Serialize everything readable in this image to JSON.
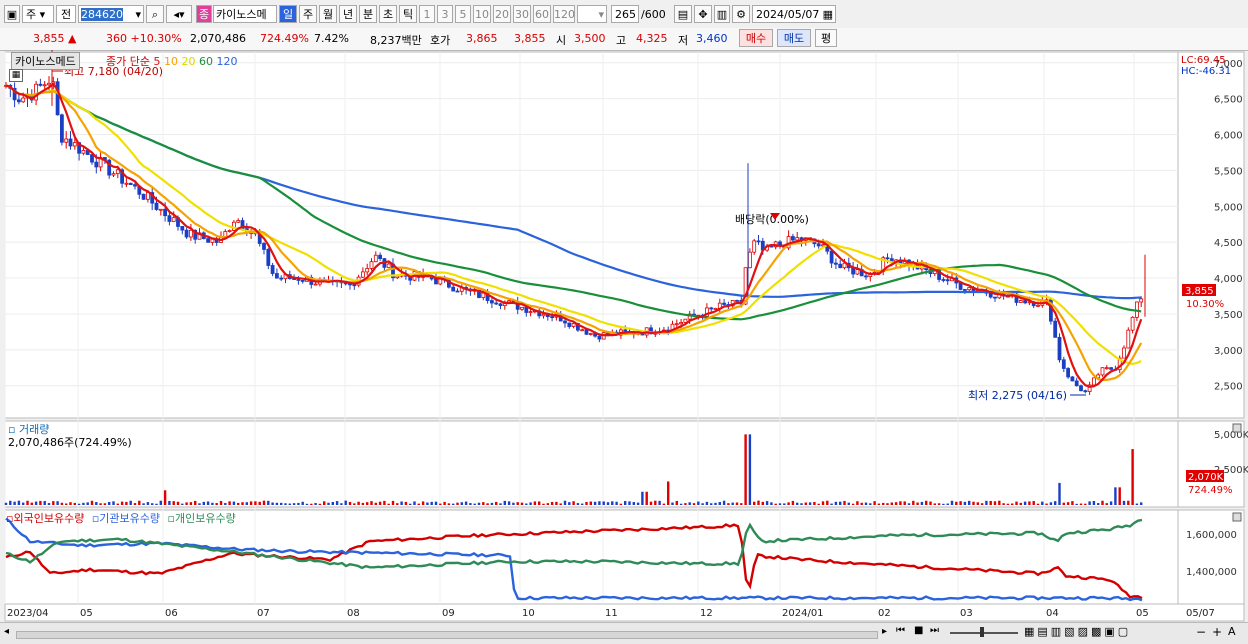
{
  "toolbar": {
    "type_select": "주",
    "range_select": "전",
    "code": "284620",
    "stock_badge": "종",
    "stock_name": "카이노스메",
    "periods": [
      "일",
      "주",
      "월",
      "년",
      "분",
      "초",
      "틱"
    ],
    "active_period": "일",
    "intervals": [
      "1",
      "3",
      "5",
      "10",
      "20",
      "30",
      "60",
      "120"
    ],
    "count": "265",
    "count_total": "/600",
    "date": "2024/05/07"
  },
  "info": {
    "price": "3,855",
    "change": "360 +10.30%",
    "volume": "2,070,486",
    "vol_ratio": "724.49%",
    "turnover": "7.42%",
    "amount": "8,237백만",
    "quote_label": "호가",
    "ask": "3,865",
    "bid": "3,855",
    "open_label": "시",
    "open": "3,500",
    "high_label": "고",
    "high": "4,325",
    "low_label": "저",
    "low": "3,460",
    "buy": "매수",
    "sell": "매도",
    "eval": "평"
  },
  "price_panel": {
    "name_tag": "카이노스메드",
    "ma_label": "종가 단순",
    "ma_periods": [
      {
        "p": "5",
        "color": "#e11111"
      },
      {
        "p": "10",
        "color": "#f5a300"
      },
      {
        "p": "20",
        "color": "#e8e800"
      },
      {
        "p": "60",
        "color": "#1a8f3a"
      },
      {
        "p": "120",
        "color": "#2b63dd"
      }
    ],
    "high_note": "최고 7,180 (04/20)",
    "low_note": "최저 2,275 (04/16)",
    "dividend_note": "배당락(0.00%)",
    "lc": "LC:69.45",
    "hc": "HC:-46.31",
    "y_ticks": [
      "7,000",
      "6,500",
      "6,000",
      "5,500",
      "5,000",
      "4,500",
      "4,000",
      "3,500",
      "3,000",
      "2,500"
    ],
    "current_price": "3,855",
    "current_change": "10.30%"
  },
  "volume_panel": {
    "title": "거래량",
    "readout": "2,070,486주(724.49%)",
    "y_ticks": [
      "5,000K",
      "2,500K"
    ],
    "current": "2,070K",
    "current_pct": "724.49%"
  },
  "holdings_panel": {
    "legend": [
      {
        "label": "외국인보유수량",
        "color": "#d40000"
      },
      {
        "label": "기관보유수량",
        "color": "#2b63dd"
      },
      {
        "label": "개인보유수량",
        "color": "#2e8b57"
      }
    ],
    "y_ticks": [
      "1,600,000",
      "1,400,000"
    ]
  },
  "x_axis": [
    "2023/04",
    "05",
    "06",
    "07",
    "08",
    "09",
    "10",
    "11",
    "12",
    "2024/01",
    "02",
    "03",
    "04",
    "05"
  ],
  "x_axis_right": "05/07"
}
